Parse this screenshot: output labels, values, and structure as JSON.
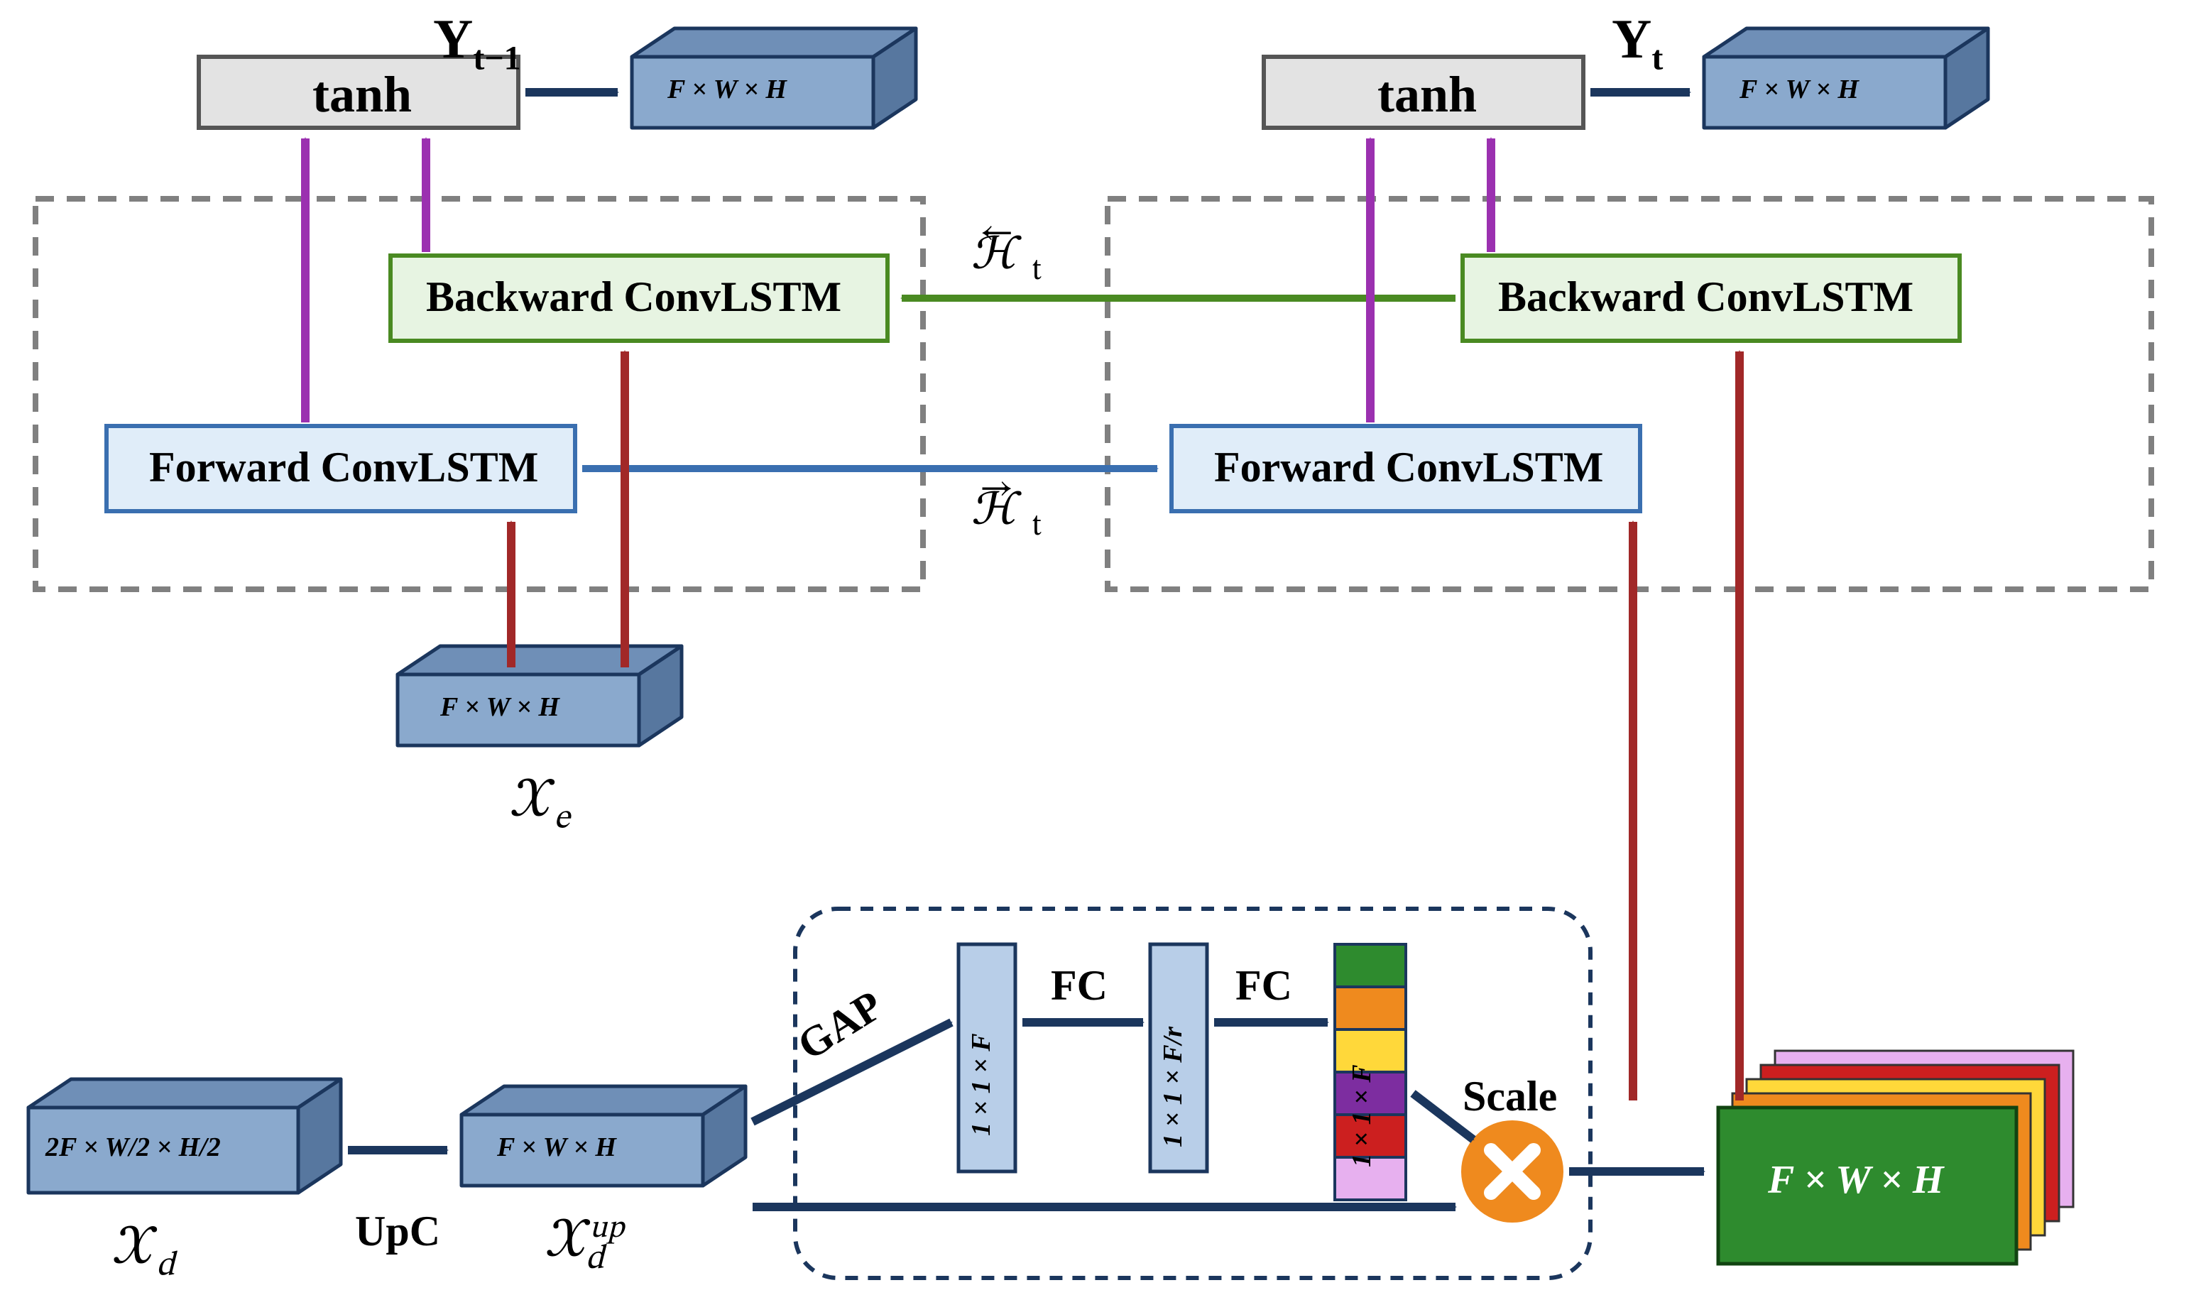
{
  "outputs": {
    "y_prev": "Y",
    "y_prev_sub": "t−1",
    "y_curr": "Y",
    "y_curr_sub": "t",
    "dims_fwh": "F × W × H"
  },
  "blocks": {
    "tanh": "tanh",
    "backward": "Backward ConvLSTM",
    "forward": "Forward ConvLSTM"
  },
  "hidden": {
    "fwd_label": "ℋ",
    "fwd_sub": "t",
    "bwd_label": "ℋ",
    "bwd_sub": "t"
  },
  "inputs": {
    "xe": "𝒳",
    "xe_sub": "e",
    "xd": "𝒳",
    "xd_sub": "d",
    "xd_up": "𝒳",
    "xd_up_sub": "d",
    "xd_up_sup": "up"
  },
  "ops": {
    "upc": "UpC",
    "gap": "GAP",
    "fc": "FC",
    "scale": "Scale"
  },
  "se": {
    "dim_1x1xF": "1 × 1 × F",
    "dim_1x1xFr": "1 × 1 × F/r",
    "dim_1x1xF_colored": "1 × 1 × F",
    "stack_fwh": "F × W × H"
  },
  "input_dims": {
    "xd": "2F × W/2 × H/2",
    "xe": "F × W × H",
    "xd_up": "F × W × H"
  }
}
